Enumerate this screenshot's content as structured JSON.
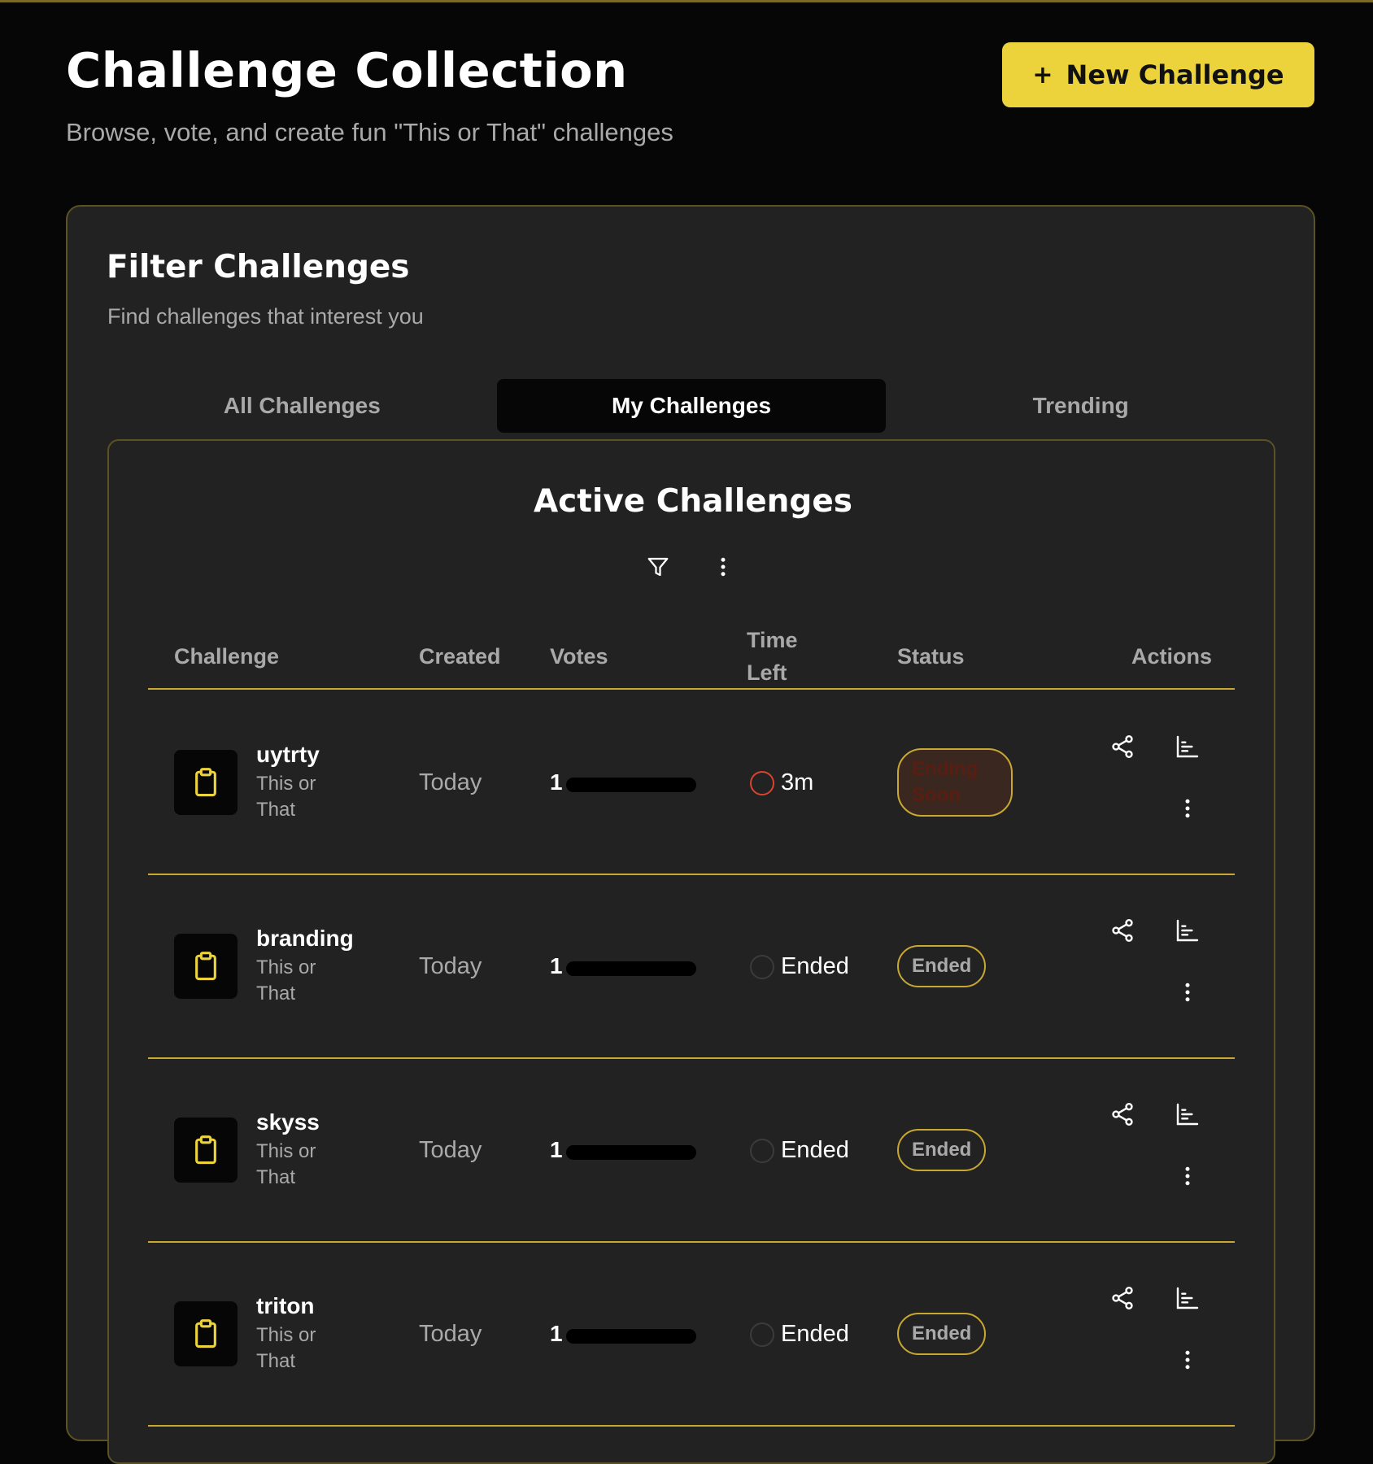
{
  "header": {
    "title": "Challenge Collection",
    "subtitle": "Browse, vote, and create fun \"This or That\" challenges",
    "new_button": {
      "icon": "+",
      "label": "New Challenge"
    }
  },
  "filter": {
    "title": "Filter Challenges",
    "subtitle": "Find challenges that interest you",
    "tabs": [
      {
        "label": "All Challenges",
        "active": false
      },
      {
        "label": "My Challenges",
        "active": true
      },
      {
        "label": "Trending",
        "active": false
      }
    ]
  },
  "table": {
    "title": "Active Challenges",
    "toolbar_icons": [
      "filter-icon",
      "more-vertical-icon"
    ],
    "columns": {
      "challenge": "Challenge",
      "created": "Created",
      "votes": "Votes",
      "time_left": "Time Left",
      "status": "Status",
      "actions": "Actions"
    },
    "rows": [
      {
        "name": "uytrty",
        "type": "This or That",
        "created": "Today",
        "votes": "1",
        "vote_fill": 1.0,
        "time_left": "3m",
        "status": "Ending Soon"
      },
      {
        "name": "branding",
        "type": "This or That",
        "created": "Today",
        "votes": "1",
        "vote_fill": 1.0,
        "time_left": "Ended",
        "status": "Ended"
      },
      {
        "name": "skyss",
        "type": "This or That",
        "created": "Today",
        "votes": "1",
        "vote_fill": 1.0,
        "time_left": "Ended",
        "status": "Ended"
      },
      {
        "name": "triton",
        "type": "This or That",
        "created": "Today",
        "votes": "1",
        "vote_fill": 1.0,
        "time_left": "Ended",
        "status": "Ended"
      }
    ],
    "row_action_icons": [
      "share-icon",
      "bar-chart-icon",
      "more-vertical-icon"
    ]
  },
  "colors": {
    "accent": "#ecd33c",
    "border": "#c9a832",
    "background": "#060606",
    "panel": "#222222",
    "muted_text": "#a9a9a9",
    "warning": "#d9432f"
  }
}
